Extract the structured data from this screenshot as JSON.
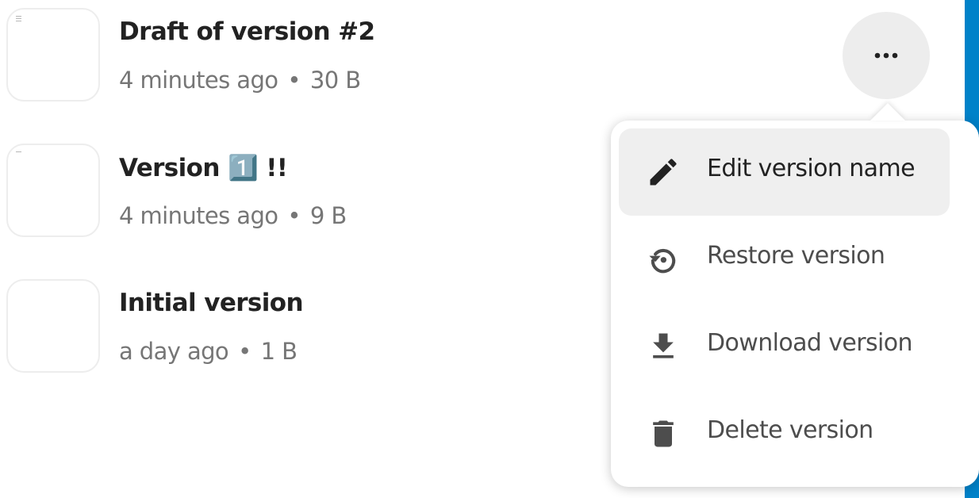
{
  "versions": [
    {
      "name": "Draft of version #2",
      "time": "4 minutes ago",
      "separator": "•",
      "size": "30 B"
    },
    {
      "name": "Version 1️⃣ !!",
      "time": "4 minutes ago",
      "separator": "•",
      "size": "9 B"
    },
    {
      "name": "Initial version",
      "time": "a day ago",
      "separator": "•",
      "size": "1 B"
    }
  ],
  "actions_button": {
    "icon": "more-horizontal-icon"
  },
  "menu": {
    "items": [
      {
        "label": "Edit version name",
        "icon": "pencil-icon"
      },
      {
        "label": "Restore version",
        "icon": "restore-history-icon"
      },
      {
        "label": "Download version",
        "icon": "download-icon"
      },
      {
        "label": "Delete version",
        "icon": "trash-icon"
      }
    ]
  },
  "colors": {
    "accent": "#0082c9",
    "text_primary": "#222222",
    "text_secondary": "#767676",
    "hover_background": "#efefef"
  }
}
